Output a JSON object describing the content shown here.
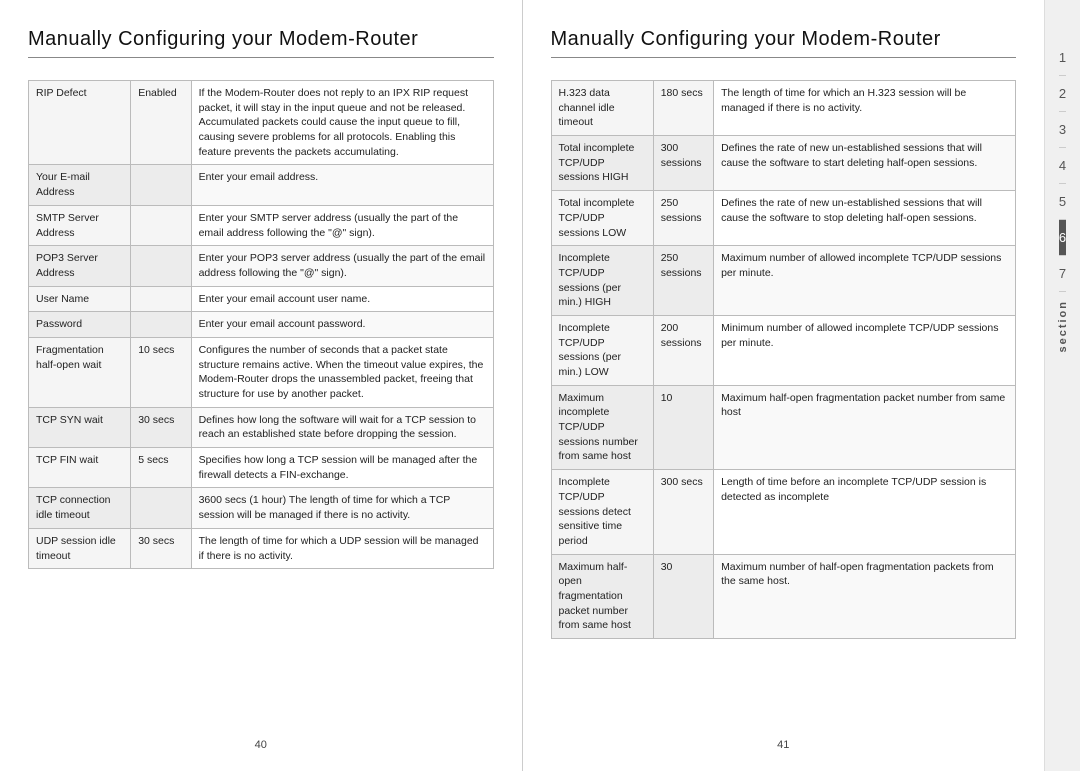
{
  "left_page": {
    "title": "Manually Configuring your Modem-Router",
    "page_number": "40",
    "rows": [
      {
        "name": "RIP Defect",
        "value": "Enabled",
        "desc": "If the Modem-Router does not reply to an IPX RIP request packet, it will stay in the input queue and not be released. Accumulated packets could cause the input queue to fill, causing severe problems for all protocols. Enabling this feature prevents the packets accumulating."
      },
      {
        "name": "Your E-mail Address",
        "value": "",
        "desc": "Enter your email address."
      },
      {
        "name": "SMTP Server Address",
        "value": "",
        "desc": "Enter your SMTP server address (usually the part of the email address following the \"@\" sign)."
      },
      {
        "name": "POP3 Server Address",
        "value": "",
        "desc": "Enter your POP3 server address (usually the part of the email address following the \"@\" sign)."
      },
      {
        "name": "User Name",
        "value": "",
        "desc": "Enter your email account user name."
      },
      {
        "name": "Password",
        "value": "",
        "desc": "Enter your email account password."
      },
      {
        "name": "Fragmentation half-open wait",
        "value": "10 secs",
        "desc": "Configures the number of seconds that a packet state structure remains active. When the timeout value expires, the Modem-Router drops the unassembled packet, freeing that structure for use by another packet."
      },
      {
        "name": "TCP SYN wait",
        "value": "30 secs",
        "desc": "Defines how long the software will wait for a TCP session to reach an established state before dropping the session."
      },
      {
        "name": "TCP FIN wait",
        "value": "5 secs",
        "desc": "Specifies how long a TCP session will be managed after the firewall detects a FIN-exchange."
      },
      {
        "name": "TCP connection idle timeout",
        "value": "",
        "desc": "3600 secs (1 hour) The length of time for which a TCP session will be managed if there is no activity."
      },
      {
        "name": "UDP session idle timeout",
        "value": "30 secs",
        "desc": "The length of time for which a UDP session will be managed if there is no activity."
      }
    ]
  },
  "right_page": {
    "title": "Manually Configuring your Modem-Router",
    "page_number": "41",
    "rows": [
      {
        "name": "H.323 data channel idle timeout",
        "value": "180 secs",
        "desc": "The length of time for which an H.323 session will be managed if there is no activity."
      },
      {
        "name": "Total incomplete TCP/UDP sessions HIGH",
        "value": "300 sessions",
        "desc": "Defines the rate of new un-established sessions that will cause the software to start deleting half-open sessions."
      },
      {
        "name": "Total incomplete TCP/UDP sessions LOW",
        "value": "250 sessions",
        "desc": "Defines the rate of new un-established sessions that will cause the software to stop deleting half-open sessions."
      },
      {
        "name": "Incomplete TCP/UDP sessions (per min.) HIGH",
        "value": "250 sessions",
        "desc": "Maximum number of allowed incomplete TCP/UDP sessions per minute."
      },
      {
        "name": "Incomplete TCP/UDP sessions (per min.) LOW",
        "value": "200 sessions",
        "desc": "Minimum number of allowed incomplete TCP/UDP sessions per minute."
      },
      {
        "name": "Maximum incomplete TCP/UDP sessions number from same host",
        "value": "10",
        "desc": "Maximum half-open fragmentation packet number from same host"
      },
      {
        "name": "Incomplete TCP/UDP sessions detect sensitive time period",
        "value": "300 secs",
        "desc": "Length of time before an incomplete TCP/UDP session is detected as incomplete"
      },
      {
        "name": "Maximum half-open fragmentation packet number from same host",
        "value": "30",
        "desc": "Maximum number of half-open fragmentation packets from the same host."
      }
    ]
  },
  "sidebar": {
    "numbers": [
      "1",
      "2",
      "3",
      "4",
      "5",
      "6",
      "7"
    ],
    "active": "6",
    "section_label": "section"
  }
}
